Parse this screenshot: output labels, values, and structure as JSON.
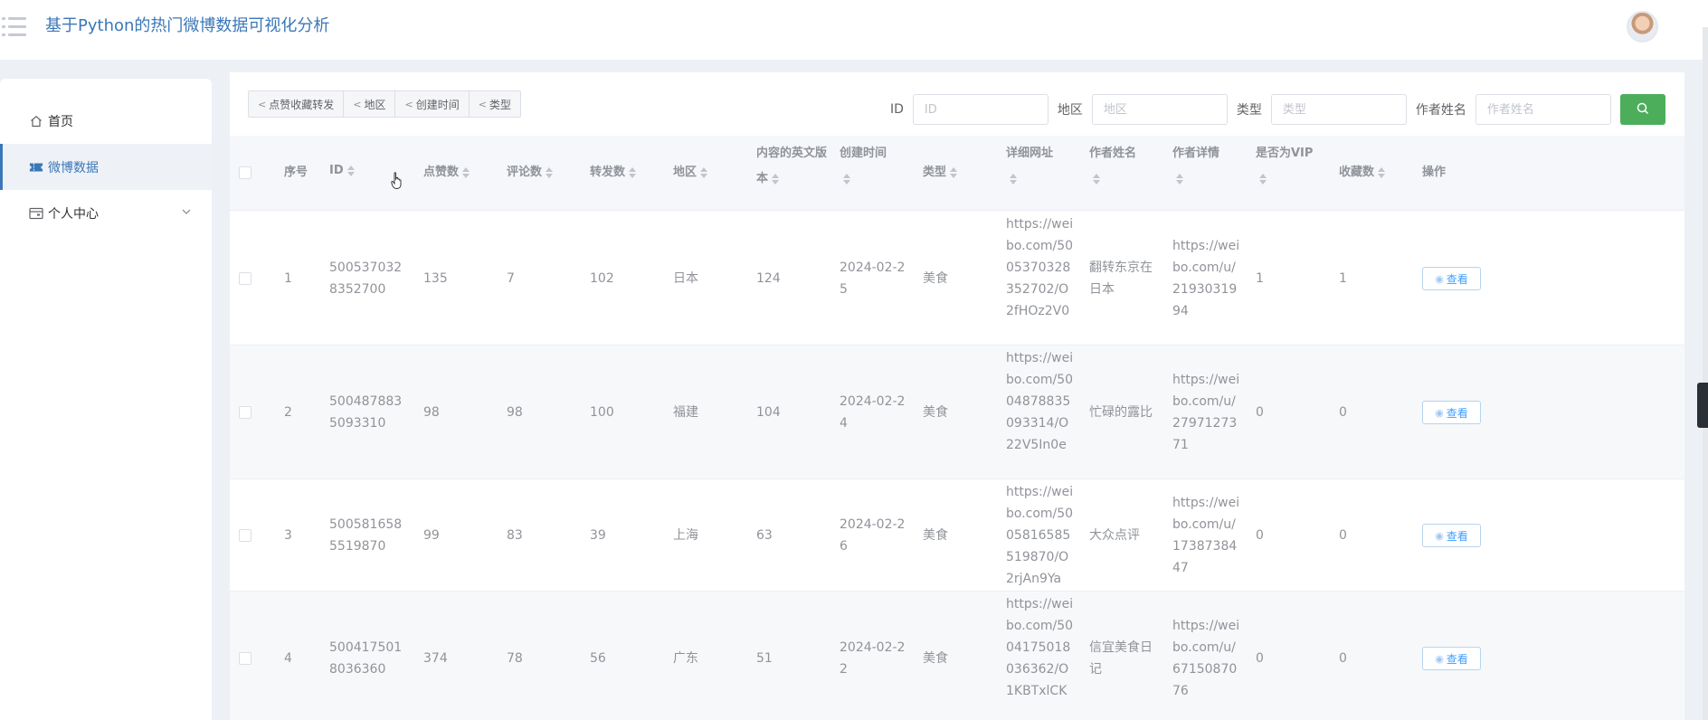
{
  "app": {
    "title": "基于Python的热门微博数据可视化分析"
  },
  "sidebar": {
    "items": [
      {
        "label": "首页",
        "icon": "home-icon"
      },
      {
        "label": "微博数据",
        "icon": "ticket-icon",
        "active": true
      },
      {
        "label": "个人中心",
        "icon": "wallet-icon",
        "expandable": true
      }
    ]
  },
  "toolbar": {
    "buttons": [
      "点赞收藏转发",
      "地区",
      "创建时间",
      "类型"
    ]
  },
  "filters": {
    "id_label": "ID",
    "id_placeholder": "ID",
    "region_label": "地区",
    "region_placeholder": "地区",
    "type_label": "类型",
    "type_placeholder": "类型",
    "author_label": "作者姓名",
    "author_placeholder": "作者姓名"
  },
  "table": {
    "headers": {
      "index": "序号",
      "id": "ID",
      "likes": "点赞数",
      "comments": "评论数",
      "reposts": "转发数",
      "region": "地区",
      "content_en": "内容的英文版本",
      "created": "创建时间",
      "type": "类型",
      "url": "详细网址",
      "author": "作者姓名",
      "author_detail": "作者详情",
      "vip": "是否为VIP",
      "favorites": "收藏数",
      "action": "操作"
    },
    "action_label": "查看",
    "rows": [
      {
        "index": "1",
        "id": "5005370328352700",
        "likes": "135",
        "comments": "7",
        "reposts": "102",
        "region": "日本",
        "content_en": "124",
        "created": "2024-02-25",
        "type": "美食",
        "url": "https://weibo.com/5005370328352702/O2fHOz2V0",
        "author": "翻转东京在日本",
        "author_detail": "https://weibo.com/u/2193031994",
        "vip": "1",
        "favorites": "1"
      },
      {
        "index": "2",
        "id": "5004878835093310",
        "likes": "98",
        "comments": "98",
        "reposts": "100",
        "region": "福建",
        "content_en": "104",
        "created": "2024-02-24",
        "type": "美食",
        "url": "https://weibo.com/5004878835093314/O22V5In0e",
        "author": "忙碌的露比",
        "author_detail": "https://weibo.com/u/2797127371",
        "vip": "0",
        "favorites": "0"
      },
      {
        "index": "3",
        "id": "5005816585519870",
        "likes": "99",
        "comments": "83",
        "reposts": "39",
        "region": "上海",
        "content_en": "63",
        "created": "2024-02-26",
        "type": "美食",
        "url": "https://weibo.com/5005816585519870/O2rjAn9Ya",
        "author": "大众点评",
        "author_detail": "https://weibo.com/u/1738738447",
        "vip": "0",
        "favorites": "0"
      },
      {
        "index": "4",
        "id": "5004175018036360",
        "likes": "374",
        "comments": "78",
        "reposts": "56",
        "region": "广东",
        "content_en": "51",
        "created": "2024-02-22",
        "type": "美食",
        "url": "https://weibo.com/5004175018036362/O1KBTxlCK",
        "author": "信宜美食日记",
        "author_detail": "https://weibo.com/u/6715087076",
        "vip": "0",
        "favorites": "0"
      }
    ]
  }
}
